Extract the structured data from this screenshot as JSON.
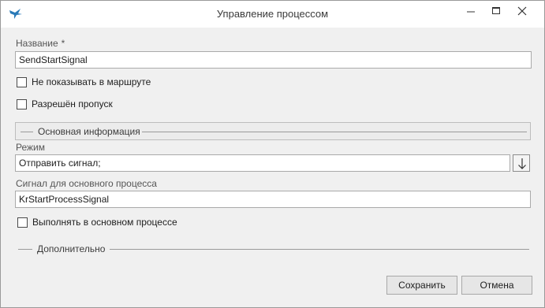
{
  "window": {
    "title": "Управление процессом",
    "icon": "bird-logo-icon",
    "controls": [
      "minimize-icon",
      "maximize-icon",
      "close-icon"
    ]
  },
  "form": {
    "name": {
      "label": "Название",
      "required_mark": "*",
      "value": "SendStartSignal"
    },
    "hide_in_route": {
      "label": "Не показывать в маршруте",
      "checked": false
    },
    "skip_allowed": {
      "label": "Разрешён пропуск",
      "checked": false
    },
    "main_group": {
      "title": "Основная информация"
    },
    "mode": {
      "label": "Режим",
      "value": "Отправить сигнал;",
      "dropdown_icon": "arrow-down-icon"
    },
    "signal": {
      "label": "Сигнал для основного процесса",
      "value": "KrStartProcessSignal"
    },
    "run_in_main": {
      "label": "Выполнять в основном процессе",
      "checked": false
    },
    "extra_group": {
      "title": "Дополнительно"
    }
  },
  "buttons": {
    "save": "Сохранить",
    "cancel": "Отмена"
  },
  "colors": {
    "title_bg": "#ffffff",
    "body_bg": "#f0f0f0",
    "logo_blue": "#2a7ab8"
  }
}
